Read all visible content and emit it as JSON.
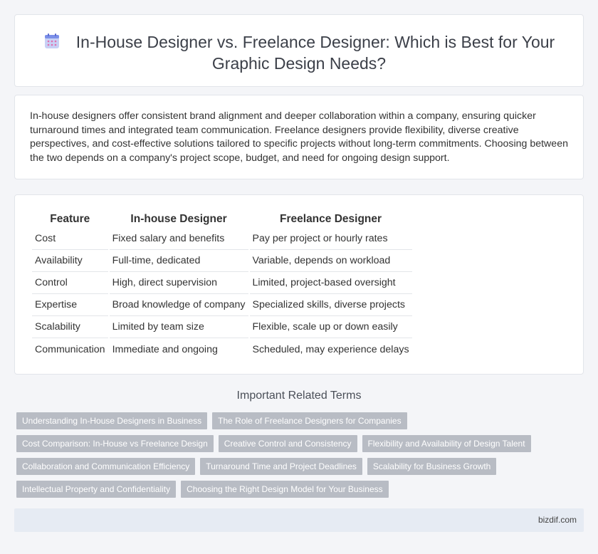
{
  "header": {
    "icon": "calendar-icon",
    "title": "In-House Designer vs. Freelance Designer: Which is Best for Your Graphic Design Needs?"
  },
  "intro": {
    "text": "In-house designers offer consistent brand alignment and deeper collaboration within a company, ensuring quicker turnaround times and integrated team communication. Freelance designers provide flexibility, diverse creative perspectives, and cost-effective solutions tailored to specific projects without long-term commitments. Choosing between the two depends on a company's project scope, budget, and need for ongoing design support."
  },
  "table": {
    "headers": [
      "Feature",
      "In-house Designer",
      "Freelance Designer"
    ],
    "rows": [
      [
        "Cost",
        "Fixed salary and benefits",
        "Pay per project or hourly rates"
      ],
      [
        "Availability",
        "Full-time, dedicated",
        "Variable, depends on workload"
      ],
      [
        "Control",
        "High, direct supervision",
        "Limited, project-based oversight"
      ],
      [
        "Expertise",
        "Broad knowledge of company",
        "Specialized skills, diverse projects"
      ],
      [
        "Scalability",
        "Limited by team size",
        "Flexible, scale up or down easily"
      ],
      [
        "Communication",
        "Immediate and ongoing",
        "Scheduled, may experience delays"
      ]
    ]
  },
  "related": {
    "heading": "Important Related Terms",
    "tags": [
      "Understanding In-House Designers in Business",
      "The Role of Freelance Designers for Companies",
      "Cost Comparison: In-House vs Freelance Design",
      "Creative Control and Consistency",
      "Flexibility and Availability of Design Talent",
      "Collaboration and Communication Efficiency",
      "Turnaround Time and Project Deadlines",
      "Scalability for Business Growth",
      "Intellectual Property and Confidentiality",
      "Choosing the Right Design Model for Your Business"
    ]
  },
  "footer": {
    "site": "bizdif.com"
  },
  "colors": {
    "tag_bg": "#b8bcc4",
    "footer_bg": "#e6ebf3",
    "icon_accent": "#7b6fd8"
  }
}
